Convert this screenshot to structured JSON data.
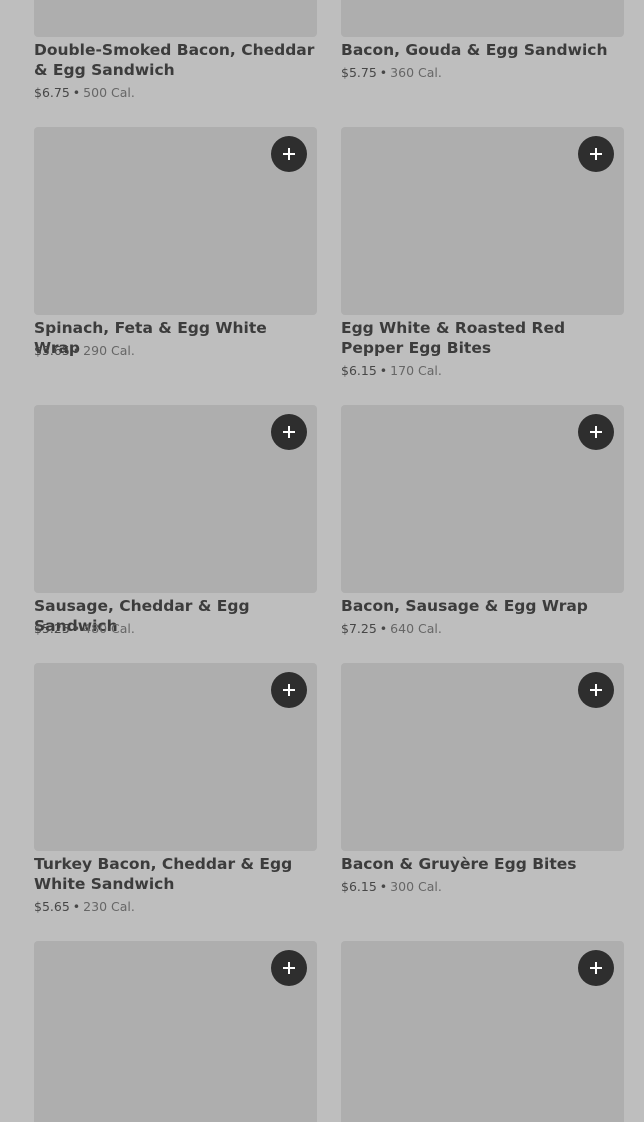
{
  "menu": {
    "add_icon": "plus-icon",
    "items": [
      {
        "name": "Double-Smoked Bacon, Cheddar & Egg Sandwich",
        "price": "$6.75",
        "separator": "•",
        "calories": "500 Cal."
      },
      {
        "name": "Bacon, Gouda & Egg Sandwich",
        "price": "$5.75",
        "separator": "•",
        "calories": "360 Cal."
      },
      {
        "name": "Spinach, Feta & Egg White Wrap",
        "price": "$5.65",
        "separator": "•",
        "calories": "290 Cal."
      },
      {
        "name": "Egg White & Roasted Red Pepper Egg Bites",
        "price": "$6.15",
        "separator": "•",
        "calories": "170 Cal."
      },
      {
        "name": "Sausage, Cheddar & Egg Sandwich",
        "price": "$5.25",
        "separator": "•",
        "calories": "480 Cal."
      },
      {
        "name": "Bacon, Sausage & Egg Wrap",
        "price": "$7.25",
        "separator": "•",
        "calories": "640 Cal."
      },
      {
        "name": "Turkey Bacon, Cheddar & Egg White Sandwich",
        "price": "$5.65",
        "separator": "•",
        "calories": "230 Cal."
      },
      {
        "name": "Bacon & Gruyère Egg Bites",
        "price": "$6.15",
        "separator": "•",
        "calories": "300 Cal."
      }
    ]
  }
}
